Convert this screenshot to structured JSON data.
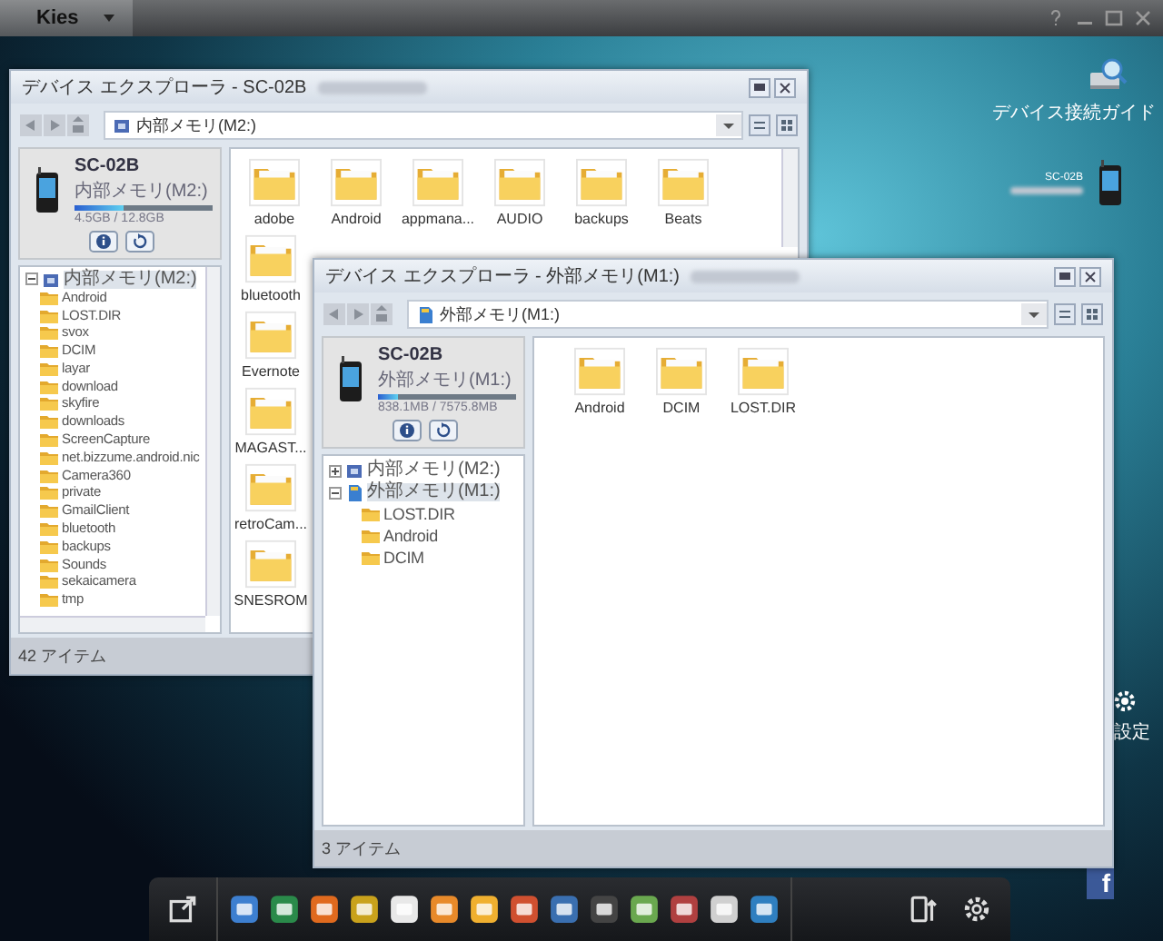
{
  "app_bar": {
    "title": "Kies"
  },
  "desktop": {
    "guide_label": "デバイス接続ガイド",
    "device_name": "SC-02B",
    "settings_label": "設定",
    "social_glyph": "f"
  },
  "windows": [
    {
      "title": "デバイス エクスプローラ - SC-02B",
      "address": {
        "text": "内部メモリ(M2:)",
        "kind": "internal"
      },
      "device": {
        "name": "SC-02B",
        "storage": "内部メモリ(M2:)",
        "level": 0.35,
        "usage": "4.5GB / 12.8GB"
      },
      "tree": [
        {
          "label": "内部メモリ(M2:)",
          "kind": "internal",
          "expanded": true,
          "selected": true,
          "children": [
            {
              "label": "Android",
              "kind": "folder"
            },
            {
              "label": "LOST.DIR",
              "kind": "folder"
            },
            {
              "label": "svox",
              "kind": "folder"
            },
            {
              "label": "DCIM",
              "kind": "folder"
            },
            {
              "label": "layar",
              "kind": "folder"
            },
            {
              "label": "download",
              "kind": "folder"
            },
            {
              "label": "skyfire",
              "kind": "folder"
            },
            {
              "label": "downloads",
              "kind": "folder"
            },
            {
              "label": "ScreenCapture",
              "kind": "folder"
            },
            {
              "label": "net.bizzume.android.nic",
              "kind": "folder"
            },
            {
              "label": "Camera360",
              "kind": "folder"
            },
            {
              "label": "private",
              "kind": "folder"
            },
            {
              "label": "GmailClient",
              "kind": "folder"
            },
            {
              "label": "bluetooth",
              "kind": "folder"
            },
            {
              "label": "backups",
              "kind": "folder"
            },
            {
              "label": "Sounds",
              "kind": "folder"
            },
            {
              "label": "sekaicamera",
              "kind": "folder"
            },
            {
              "label": "tmp",
              "kind": "folder"
            }
          ]
        }
      ],
      "items": [
        {
          "label": "adobe"
        },
        {
          "label": "Android"
        },
        {
          "label": "appmana..."
        },
        {
          "label": "AUDIO"
        },
        {
          "label": "backups"
        },
        {
          "label": "Beats"
        }
      ],
      "column_items": [
        {
          "label": "bluetooth"
        },
        {
          "label": "Evernote"
        },
        {
          "label": "MAGAST..."
        },
        {
          "label": "retroCam..."
        },
        {
          "label": "SNESROM"
        }
      ],
      "status": "42 アイテム"
    },
    {
      "title": "デバイス エクスプローラ - 外部メモリ(M1:)",
      "address": {
        "text": "外部メモリ(M1:)",
        "kind": "sd"
      },
      "device": {
        "name": "SC-02B",
        "storage": "外部メモリ(M1:)",
        "level": 0.15,
        "usage": "838.1MB / 7575.8MB"
      },
      "tree": [
        {
          "label": "内部メモリ(M2:)",
          "kind": "internal",
          "expanded": false,
          "selected": false
        },
        {
          "label": "外部メモリ(M1:)",
          "kind": "sd",
          "expanded": true,
          "selected": true,
          "children": [
            {
              "label": "LOST.DIR",
              "kind": "folder"
            },
            {
              "label": "Android",
              "kind": "folder"
            },
            {
              "label": "DCIM",
              "kind": "folder"
            }
          ]
        }
      ],
      "items": [
        {
          "label": "Android"
        },
        {
          "label": "DCIM"
        },
        {
          "label": "LOST.DIR"
        }
      ],
      "status": "3 アイテム"
    }
  ]
}
